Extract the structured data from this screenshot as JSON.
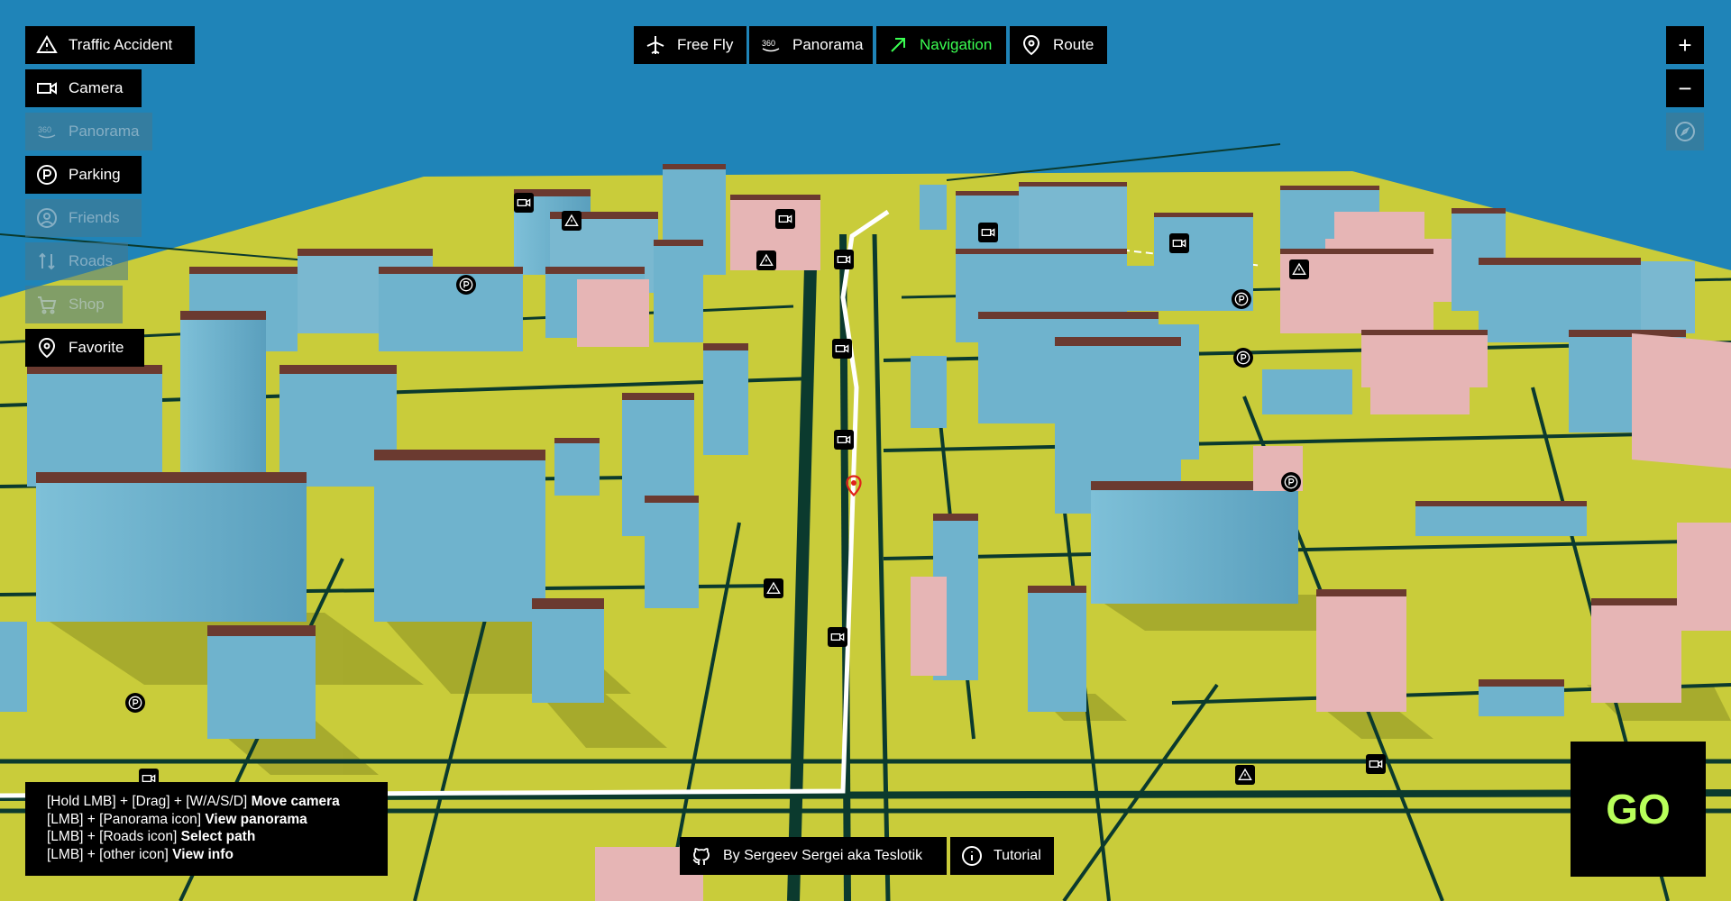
{
  "toolbar_left": [
    {
      "label": "Traffic Accident",
      "icon": "warning-icon",
      "state": "enabled"
    },
    {
      "label": "Camera",
      "icon": "camera-icon",
      "state": "enabled"
    },
    {
      "label": "Panorama",
      "icon": "panorama-360-icon",
      "state": "disabled"
    },
    {
      "label": "Parking",
      "icon": "parking-icon",
      "state": "enabled"
    },
    {
      "label": "Friends",
      "icon": "user-icon",
      "state": "disabled"
    },
    {
      "label": "Roads",
      "icon": "roads-icon",
      "state": "disabled"
    },
    {
      "label": "Shop",
      "icon": "cart-icon",
      "state": "disabled"
    },
    {
      "label": "Favorite",
      "icon": "location-pin-icon",
      "state": "enabled"
    }
  ],
  "modes": [
    {
      "label": "Free Fly",
      "icon": "airplane-icon",
      "active": false
    },
    {
      "label": "Panorama",
      "icon": "panorama-360-icon",
      "active": false
    },
    {
      "label": "Navigation",
      "icon": "arrow-up-right-icon",
      "active": true
    },
    {
      "label": "Route",
      "icon": "location-pin-icon",
      "active": false
    }
  ],
  "zoom": {
    "in": "+",
    "out": "−",
    "compass_icon": "compass-icon"
  },
  "help": [
    {
      "keys": "[Hold LMB] + [Drag] + [W/A/S/D]",
      "action": "Move camera"
    },
    {
      "keys": "[LMB] + [Panorama icon]",
      "action": "View panorama"
    },
    {
      "keys": "[LMB] + [Roads icon]",
      "action": "Select path"
    },
    {
      "keys": "[LMB] + [other icon]",
      "action": "View info"
    }
  ],
  "footer": {
    "credit": "By Sergeev Sergei aka Teslotik",
    "credit_icon": "github-icon",
    "tutorial": "Tutorial",
    "tutorial_icon": "info-icon"
  },
  "go_label": "GO",
  "colors": {
    "sky": "#1f84b8",
    "ground": "#c9cc3a",
    "road": "#0b3a2e",
    "building_side": "#6fb3cd",
    "building_light": "#e6b5b5",
    "roof": "#6b3a30",
    "active": "#3bff52",
    "go": "#b8ff5a"
  }
}
